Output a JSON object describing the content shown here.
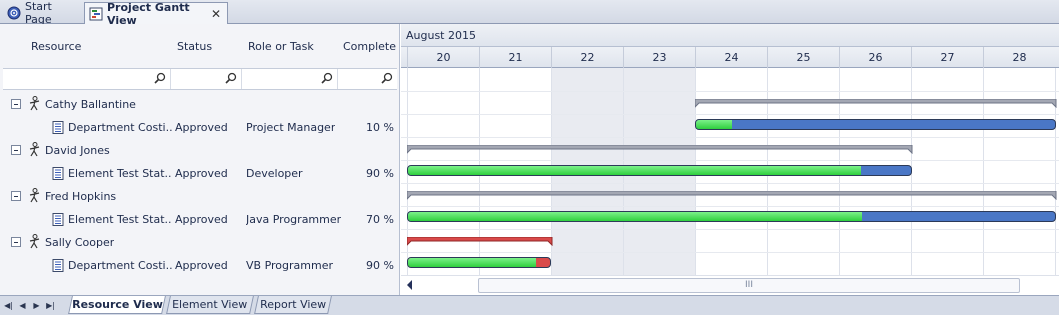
{
  "doc_tabs": [
    {
      "label": "Start Page",
      "icon": "start-page-icon",
      "active": false
    },
    {
      "label": "Project Gantt View",
      "icon": "gantt-view-icon",
      "active": true
    }
  ],
  "columns": {
    "resource": "Resource",
    "status": "Status",
    "role": "Role or Task",
    "complete": "Complete"
  },
  "rows": [
    {
      "type": "resource",
      "label": "Cathy Ballantine"
    },
    {
      "type": "task",
      "label": "Department Costi...",
      "status": "Approved",
      "role": "Project Manager",
      "complete": "10 %"
    },
    {
      "type": "resource",
      "label": "David Jones"
    },
    {
      "type": "task",
      "label": "Element Test Stat...",
      "status": "Approved",
      "role": "Developer",
      "complete": "90 %"
    },
    {
      "type": "resource",
      "label": "Fred Hopkins"
    },
    {
      "type": "task",
      "label": "Element Test Stat...",
      "status": "Approved",
      "role": "Java Programmer",
      "complete": "70 %"
    },
    {
      "type": "resource",
      "label": "Sally Cooper"
    },
    {
      "type": "task",
      "label": "Department Costi...",
      "status": "Approved",
      "role": "VB Programmer",
      "complete": "90 %"
    }
  ],
  "gantt": {
    "month": "August 2015",
    "days": [
      "20",
      "21",
      "22",
      "23",
      "24",
      "25",
      "26",
      "27",
      "28"
    ],
    "weekend_days": [
      "22",
      "23"
    ],
    "colors": {
      "progress": "#2fcf3e",
      "remaining": "#4a77c6",
      "overdue": "#d94a4a",
      "summary": "#a3a7b3",
      "summary_overdue": "#d94a4a"
    }
  },
  "bottom_tabs": [
    {
      "label": "Resource View",
      "active": true
    },
    {
      "label": "Element View",
      "active": false
    },
    {
      "label": "Report View",
      "active": false
    }
  ],
  "scroll_thumb": "III"
}
